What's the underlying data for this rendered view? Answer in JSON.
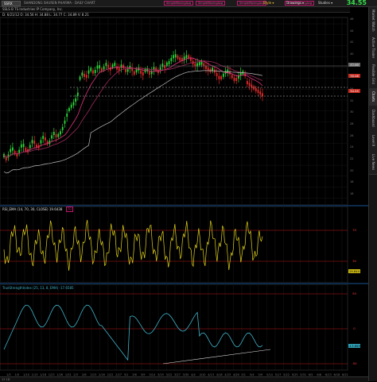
{
  "toolbar": {
    "symbol": "SSRX",
    "description": "SHANDONG SHUREN PHARMA · DAILY CHART",
    "status": "",
    "buttons": [
      "Style ▾",
      "Drawings ▾",
      "Studies ▾"
    ],
    "last_price": "34.55",
    "tags": [
      "SimpleMovingAvg",
      "SimpleMovingAvg",
      "SimpleMovingAvg",
      "SimpleMovingAvg"
    ]
  },
  "subbar": {
    "company": "SSLS B TS Industries IP Company, Inc.",
    "ohlc": "D: 6/21/12   O: 34.56   H: 34.88   L: 34.77   C: 34.89   V: 8.21"
  },
  "sidebar": {
    "tabs": [
      "Market Watch",
      "Active Trader",
      "Flexible Grid",
      "Charts",
      "Dashboard",
      "Level II",
      "Live News"
    ]
  },
  "price_pane": {
    "tags": [
      {
        "value": "42.00",
        "color": "#7a7a7a"
      },
      {
        "value": "38.08",
        "color": "#d2372b"
      },
      {
        "value": "34.55",
        "color": "#d2372b"
      }
    ],
    "axis": [
      "46",
      "44",
      "42",
      "40",
      "38",
      "36",
      "34",
      "32",
      "30",
      "28",
      "26",
      "24",
      "22",
      "20",
      "18",
      "16"
    ]
  },
  "rsi_pane": {
    "title": "RSI_EMA (14, 70, 30, CLOSE)  19.6438",
    "tag": "70",
    "levels": [
      "70",
      "30"
    ],
    "current": "19.644"
  },
  "tsi_pane": {
    "title": "TrueStrengthIndex (25, 13, 8, EMA)  -17.6585",
    "levels": [
      "50",
      "0",
      "-50"
    ],
    "current": "-17.659"
  },
  "dates": [
    "1/3",
    "1/5",
    "1/10",
    "1/13",
    "1/18",
    "1/23",
    "1/26",
    "1/31",
    "2/3",
    "2/8",
    "2/13",
    "2/16",
    "2/22",
    "2/27",
    "3/1",
    "3/6",
    "3/9",
    "3/14",
    "3/19",
    "3/22",
    "3/27",
    "3/30",
    "4/4",
    "4/10",
    "4/13",
    "4/18",
    "4/23",
    "4/26",
    "5/1",
    "5/4",
    "5/9",
    "5/14",
    "5/17",
    "5/22",
    "5/25",
    "5/31",
    "6/5",
    "6/8",
    "6/13",
    "6/18",
    "6/21"
  ],
  "bottom": {
    "label": "1Y 1D"
  },
  "colors": {
    "candle_up": "#2bd63a",
    "candle_down": "#e02a2a",
    "ma_fast": "#e0337c",
    "ma_mid": "#9b2a5a",
    "ma_slow": "#bdbdbd",
    "rsi_line": "#e2d21b",
    "tsi_line": "#3fb3c9",
    "level_line": "#c01a1a"
  }
}
